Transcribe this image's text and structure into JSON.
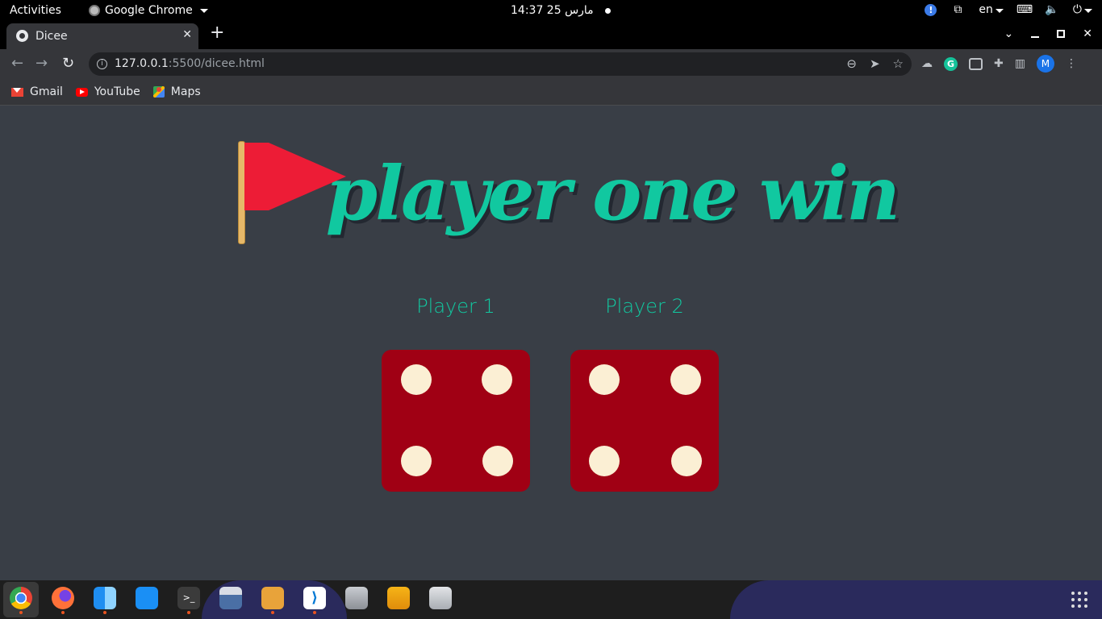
{
  "topbar": {
    "activities": "Activities",
    "app_name": "Google Chrome",
    "clock": "14:37  25 مارس",
    "language": "en"
  },
  "browser": {
    "tab_title": "Dicee",
    "url_host": "127.0.0.1",
    "url_path": ":5500/dicee.html",
    "avatar_letter": "M",
    "bookmarks": [
      {
        "label": "Gmail",
        "icon": "gmail-icon"
      },
      {
        "label": "YouTube",
        "icon": "youtube-icon"
      },
      {
        "label": "Maps",
        "icon": "maps-icon"
      }
    ]
  },
  "page": {
    "heading": "player one win",
    "heading_icon": "red-flag-icon",
    "players": [
      {
        "label": "Player 1",
        "die_value": 4
      },
      {
        "label": "Player 2",
        "die_value": 4
      }
    ],
    "colors": {
      "background": "#393e46",
      "accent": "#11c8a0",
      "die": "#a00014",
      "pip": "#fbefd4"
    }
  },
  "dock": {
    "apps": [
      "chrome-icon",
      "firefox-icon",
      "finder-icon",
      "app-store-icon",
      "terminal-icon",
      "screenshot-icon",
      "archive-icon",
      "vscode-icon",
      "drive-icon",
      "files-icon",
      "usb-drive-icon"
    ]
  }
}
